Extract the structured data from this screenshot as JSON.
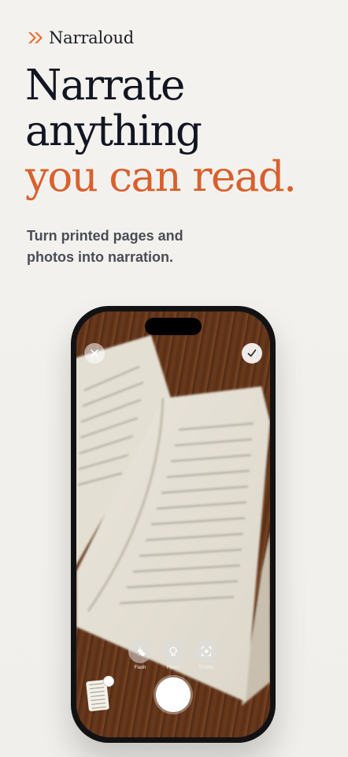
{
  "brand": {
    "name": "Narraloud",
    "icon": "double-chevron-icon",
    "accent": "#F06A35"
  },
  "hero": {
    "line1": "Narrate",
    "line2": "anything",
    "line3": "you can read.",
    "subtitle": "Turn printed pages and photos into narration."
  },
  "camera": {
    "close_icon": "close-icon",
    "confirm_icon": "checkmark-icon",
    "tools": [
      {
        "label": "Flash",
        "icon": "flash-off-icon"
      },
      {
        "label": "Filters",
        "icon": "filters-icon"
      },
      {
        "label": "Shutter",
        "icon": "scan-icon"
      }
    ]
  },
  "colors": {
    "background": "#F3F1ED",
    "headline": "#121522",
    "accent": "#D9602D",
    "body": "#4A4D57"
  }
}
